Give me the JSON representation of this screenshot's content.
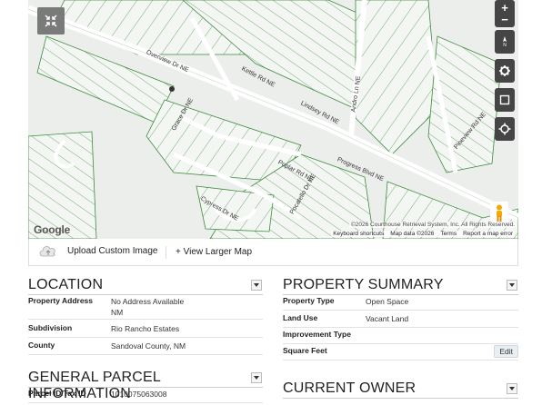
{
  "map": {
    "streets": [
      "Overview Dr NE",
      "Progress Blvd NE",
      "Kettle Rd NE",
      "Lindsey Rd NE",
      "Cypress Dr NE",
      "Poplar Rd NE",
      "Pocatello Dr NE",
      "Andro Ln NE",
      "Grace Dr NE",
      "Pineview Rd NE"
    ],
    "copyright": "©2026 Courthouse Retrieval System, Inc. All Rights Reserved.",
    "footer_links": [
      "Keyboard shortcuts",
      "Map data ©2026",
      "Terms",
      "Report a map error"
    ],
    "google": "Google"
  },
  "toolbar": {
    "upload_label": "Upload Custom Image",
    "larger_label": "+ View Larger Map"
  },
  "location": {
    "title": "LOCATION",
    "rows": [
      {
        "key": "Property Address",
        "value": "No Address Available",
        "value2": "NM"
      },
      {
        "key": "Subdivision",
        "value": "Rio Rancho Estates"
      },
      {
        "key": "County",
        "value": "Sandoval County, NM"
      }
    ]
  },
  "summary": {
    "title": "PROPERTY SUMMARY",
    "rows": [
      {
        "key": "Property Type",
        "value": "Open Space"
      },
      {
        "key": "Land Use",
        "value": "Vacant Land"
      },
      {
        "key": "Improvement Type",
        "value": ""
      },
      {
        "key": "Square Feet",
        "value": ""
      }
    ],
    "edit_label": "Edit"
  },
  "parcel": {
    "title": "GENERAL PARCEL INFORMATION",
    "rows": [
      {
        "key": "Parcel ID/Tax ID",
        "value": "1010075063008"
      }
    ]
  },
  "owner": {
    "title": "CURRENT OWNER"
  },
  "colors": {
    "parcel_line": "#3d8b3d",
    "street": "#ffffff",
    "map_bg": "#f1f3f1",
    "control_dark": "#454545"
  }
}
